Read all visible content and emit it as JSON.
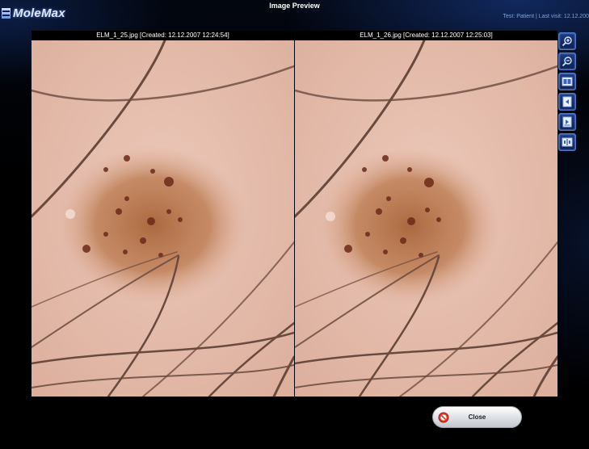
{
  "app": {
    "logo_text": "MoleMax",
    "window_title": "Image Preview",
    "status": "Test: Patient | Last visit: 12.12.200"
  },
  "images": [
    {
      "caption": "ELM_1_25.jpg [Created: 12.12.2007 12:24:54]"
    },
    {
      "caption": "ELM_1_26.jpg [Created: 12.12.2007 12:25:03]"
    }
  ],
  "toolbar": {
    "buttons": [
      {
        "icon": "zoom-in-icon"
      },
      {
        "icon": "zoom-out-icon"
      },
      {
        "icon": "compare-images-icon"
      },
      {
        "icon": "previous-image-icon"
      },
      {
        "icon": "next-image-icon"
      },
      {
        "icon": "split-view-icon"
      }
    ]
  },
  "actions": {
    "close_label": "Close"
  },
  "colors": {
    "background": "#000000",
    "accent": "#2a55b0",
    "skin": "#e7c2b4",
    "lesion": "#b06a3c"
  }
}
